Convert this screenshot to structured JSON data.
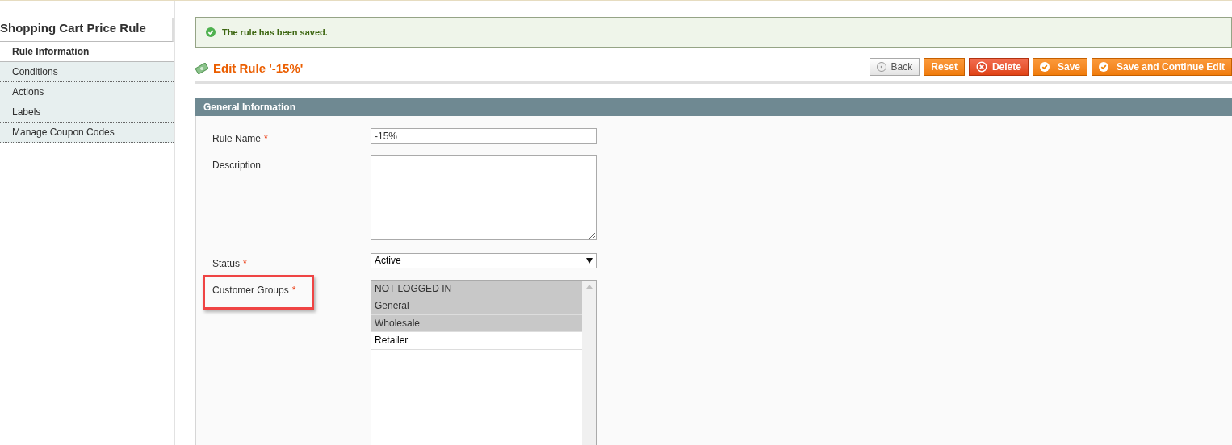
{
  "sidebar": {
    "title": "Shopping Cart Price Rule",
    "tabs": [
      {
        "label": "Rule Information",
        "selected": true
      },
      {
        "label": "Conditions",
        "selected": false
      },
      {
        "label": "Actions",
        "selected": false
      },
      {
        "label": "Labels",
        "selected": false
      },
      {
        "label": "Manage Coupon Codes",
        "selected": false
      }
    ]
  },
  "message": {
    "text": "The rule has been saved."
  },
  "page_title": "Edit Rule '-15%'",
  "buttons": [
    {
      "kind": "back",
      "label": "Back"
    },
    {
      "kind": "plain",
      "label": "Reset"
    },
    {
      "kind": "delete",
      "label": "Delete"
    },
    {
      "kind": "save",
      "label": "Save"
    },
    {
      "kind": "save",
      "label": "Save and Continue Edit"
    }
  ],
  "section": {
    "title": "General Information",
    "fields": [
      {
        "kind": "text",
        "label": "Rule Name",
        "required_mark": "*",
        "highlighted": false,
        "value": "-15%"
      },
      {
        "kind": "textarea",
        "label": "Description",
        "highlighted": false
      },
      {
        "kind": "select",
        "label": "Status",
        "required_mark": "*",
        "highlighted": false,
        "value": "Active"
      },
      {
        "kind": "multiselect",
        "label": "Customer Groups",
        "required_mark": "*",
        "highlighted": true,
        "options": [
          {
            "label": "NOT LOGGED IN",
            "selected": true
          },
          {
            "label": "General",
            "selected": true
          },
          {
            "label": "Wholesale",
            "selected": true
          },
          {
            "label": "Retailer",
            "selected": false
          }
        ]
      }
    ]
  }
}
